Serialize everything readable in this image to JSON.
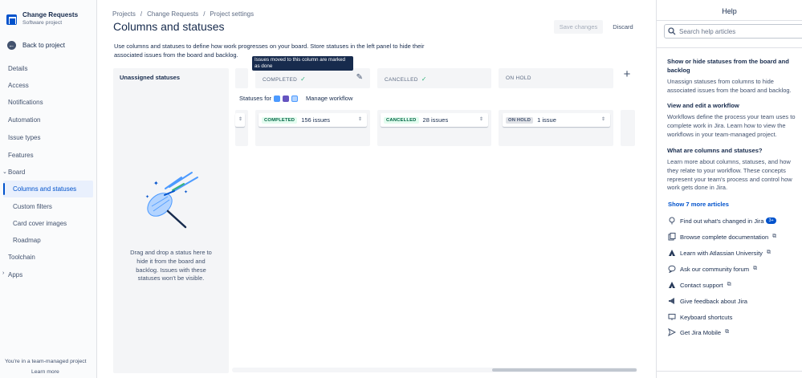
{
  "project": {
    "name": "Change Requests",
    "type": "Software project"
  },
  "nav": {
    "back": "Back to project",
    "items": {
      "details": "Details",
      "access": "Access",
      "notifications": "Notifications",
      "automation": "Automation",
      "issue_types": "Issue types",
      "features": "Features",
      "board": "Board",
      "columns": "Columns and statuses",
      "filters": "Custom filters",
      "cover": "Card cover images",
      "roadmap": "Roadmap",
      "toolchain": "Toolchain",
      "apps": "Apps"
    },
    "footer_text": "You're in a team-managed project",
    "footer_link": "Learn more"
  },
  "breadcrumb": [
    "Projects",
    "/",
    "Change Requests",
    "/",
    "Project settings"
  ],
  "page": {
    "title": "Columns and statuses",
    "save": "Save changes",
    "discard": "Discard",
    "description": "Use columns and statuses to define how work progresses on your board. Store statuses in the left panel to hide their associated issues from the board and backlog."
  },
  "unassigned": {
    "title": "Unassigned statuses",
    "hint": "Drag and drop a status here to hide it from the board and backlog. Issues with these statuses won't be visible."
  },
  "tooltip": "Issues moved to this column are marked as done",
  "columns": [
    {
      "title": "COMPLETED",
      "done": "✓"
    },
    {
      "title": "CANCELLED",
      "done": "✓"
    },
    {
      "title": "ON HOLD"
    }
  ],
  "add_column": "+",
  "statuses_for": "Statuses for",
  "manage_workflow": "Manage workflow",
  "cards": [
    {
      "lozenge": "COMPLETED",
      "count": "156 issues",
      "color": "#006644",
      "bg": "#e3fcef"
    },
    {
      "lozenge": "CANCELLED",
      "count": "28 issues",
      "color": "#006644",
      "bg": "#e3fcef"
    },
    {
      "lozenge": "ON HOLD",
      "count": "1 issue",
      "color": "#42526e",
      "bg": "#dfe1e6"
    }
  ],
  "help": {
    "title": "Help",
    "search_placeholder": "Search help articles",
    "sections": [
      {
        "heading": "Show or hide statuses from the board and backlog",
        "body": "Unassign statuses from columns to hide associated issues from the board and backlog."
      },
      {
        "heading": "View and edit a workflow",
        "body": "Workflows define the process your team uses to complete work in Jira. Learn how to view the workflows in your team-managed project."
      },
      {
        "heading": "What are columns and statuses?",
        "body": "Learn more about columns, statuses, and how they relate to your workflow. These concepts represent your team's process and control how work gets done in Jira."
      }
    ],
    "show_more": "Show 7 more articles",
    "links": {
      "whats_changed": "Find out what's changed in Jira",
      "whats_changed_badge": "3+",
      "documentation": "Browse complete documentation",
      "university": "Learn with Atlassian University",
      "community": "Ask our community forum",
      "support": "Contact support",
      "feedback": "Give feedback about Jira",
      "shortcuts": "Keyboard shortcuts",
      "mobile": "Get Jira Mobile"
    }
  }
}
